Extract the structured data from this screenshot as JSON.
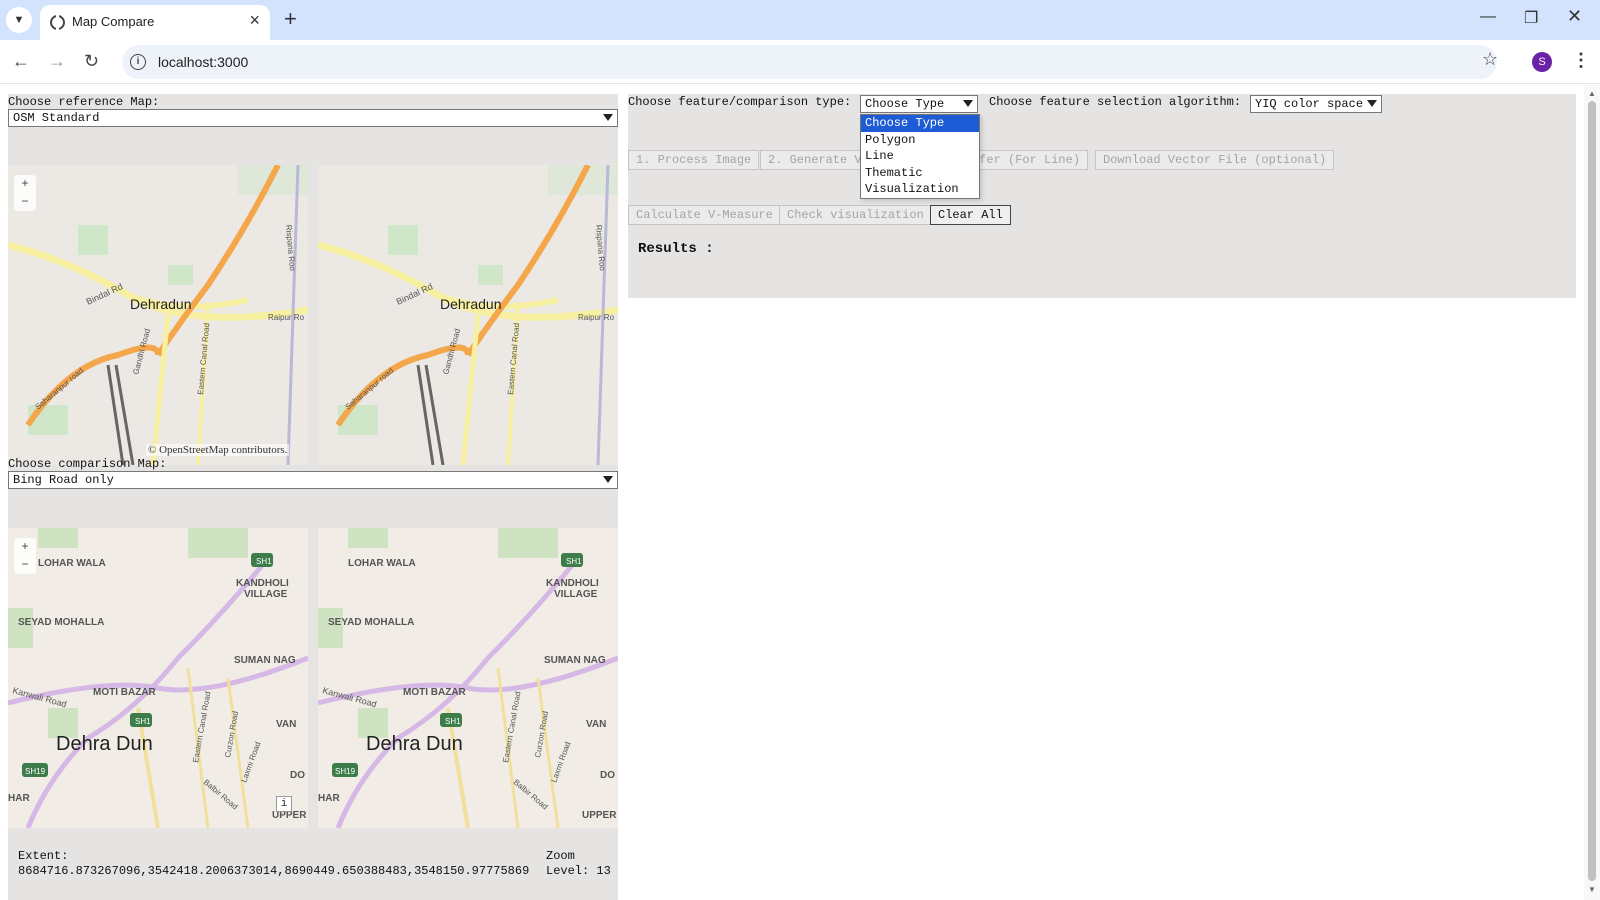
{
  "browser": {
    "tab_title": "Map Compare",
    "url": "localhost:3000",
    "profile_initial": "S"
  },
  "left": {
    "ref_label": "Choose reference Map:",
    "ref_selected": "OSM Standard",
    "cmp_label": "Choose comparison Map:",
    "cmp_selected": "Bing Road only",
    "osm": {
      "city": "Dehradun",
      "roads": [
        "Bindal Rd",
        "Gandhi Road",
        "Eastern Canal Road",
        "Saharanpur road",
        "Raipur Ro",
        "Rispana Roo"
      ],
      "attribution": "© OpenStreetMap contributors."
    },
    "bing": {
      "city": "Dehra Dun",
      "places": [
        "LOHAR WALA",
        "KANDHOLI",
        "VILLAGE",
        "SEYAD MOHALLA",
        "SUMAN NAG",
        "MOTI BAZAR",
        "VAN",
        "HAR",
        "DO",
        "UPPER"
      ],
      "roads": [
        "Kanwali Road",
        "Eastern Canal Road",
        "Curzon Road",
        "Laxmi Road",
        "Balbir Road"
      ],
      "shields": [
        "SH1",
        "SH1",
        "SH19"
      ],
      "info": "i"
    },
    "extent_label": "Extent:",
    "extent_value": "8684716.873267096,3542418.2006373014,8690449.650388483,3548150.97775869",
    "zoom_label": "Zoom",
    "zoom_value": "Level: 13"
  },
  "right": {
    "type_label": "Choose feature/comparison type:",
    "type_selected": "Choose Type",
    "algo_label": "Choose feature selection algorithm:",
    "algo_selected": "YIQ color space",
    "type_options": [
      "Choose Type",
      "Polygon",
      "Line",
      "Thematic",
      "Visualization"
    ],
    "buttons": {
      "process": "1. Process Image",
      "generate": "2. Generate Ve",
      "buffer": "ffer (For Line)",
      "download": "Download Vector File (optional)",
      "vmeasure": "Calculate V-Measure",
      "checkvis": "Check visualization",
      "clear": "Clear All"
    },
    "results_label": "Results :"
  }
}
